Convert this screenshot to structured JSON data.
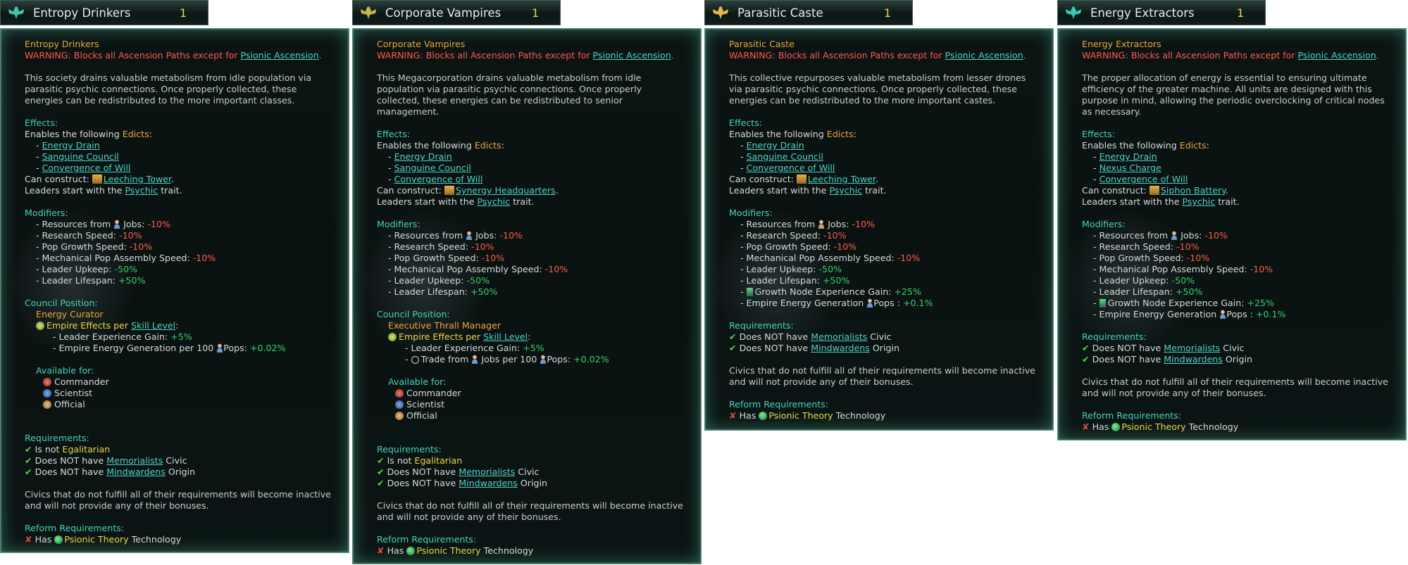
{
  "common": {
    "warning_prefix": "WARNING: Blocks all Ascension Paths except for",
    "warning_link": "Psionic Ascension",
    "effects_label": "Effects:",
    "enables_prefix": "Enables the following",
    "edicts_word": "Edicts",
    "can_construct": "Can construct:",
    "leaders_prefix": "Leaders start with the",
    "psychic": "Psychic",
    "trait_word": "trait.",
    "modifiers_label": "Modifiers:",
    "mod_resources": "- Resources from",
    "mod_jobs": "Jobs:",
    "mod_research": "- Research Speed:",
    "mod_pop_growth": "- Pop Growth Speed:",
    "mod_mech": "- Mechanical Pop Assembly Speed:",
    "mod_upkeep": "- Leader Upkeep:",
    "mod_lifespan": "- Leader Lifespan:",
    "mod_growth_node": "Growth Node Experience Gain:",
    "mod_energy_gen": "- Empire Energy Generation",
    "mod_pops_colon": "Pops :",
    "val_neg10": "-10%",
    "val_neg50": "-50%",
    "val_pos50": "+50%",
    "val_pos25": "+25%",
    "val_pos01": "+0.1%",
    "council_label": "Council Position:",
    "empire_effects": "Empire Effects per",
    "skill_level": "Skill Level",
    "leader_xp": "- Leader Experience Gain:",
    "val_pos5": "+5%",
    "available_for": "Available for:",
    "commander": "Commander",
    "scientist": "Scientist",
    "official": "Official",
    "requirements_label": "Requirements:",
    "is_not": "Is not",
    "egalitarian": "Egalitarian",
    "does_not_have": "Does NOT have",
    "memorialists": "Memorialists",
    "civic_word": "Civic",
    "mindwardens": "Mindwardens",
    "origin_word": "Origin",
    "civics_note": "Civics that do not fulfill all of their requirements will become inactive and will not provide any of their bonuses.",
    "reform_label": "Reform Requirements:",
    "has_word": "Has",
    "psionic_theory": "Psionic Theory",
    "technology_word": "Technology"
  },
  "panels": [
    {
      "name": "Entropy Drinkers",
      "count": "1",
      "emblem_color": "#3fc9b0",
      "description": "This society drains valuable metabolism from idle population via parasitic psychic connections. Once properly collected, these energies can be redistributed to the more important classes.",
      "edicts": [
        "Energy Drain",
        "Sanguine Council",
        "Convergence of Will"
      ],
      "building": "Leeching Tower",
      "council_title": "Energy Curator",
      "energy_per": "- Empire Energy Generation per 100",
      "energy_val": "+0.02%"
    },
    {
      "name": "Corporate Vampires",
      "count": "1",
      "emblem_color": "#c9b94a",
      "description": "This Megacorporation drains valuable metabolism from idle population via parasitic psychic connections. Once properly collected, these energies can be redistributed to senior management.",
      "edicts": [
        "Energy Drain",
        "Sanguine Council",
        "Convergence of Will"
      ],
      "building": "Synergy Headquarters",
      "council_title": "Executive Thrall Manager",
      "trade_from": "Trade from",
      "jobs_per": "Jobs per 100",
      "pops_colon": "Pops:",
      "trade_val": "+0.02%"
    },
    {
      "name": "Parasitic Caste",
      "count": "1",
      "emblem_color": "#e8b84a",
      "description": "This collective repurposes valuable metabolism from lesser drones via parasitic psychic connections. Once properly collected, these energies can be redistributed to the more important castes.",
      "edicts": [
        "Energy Drain",
        "Sanguine Council",
        "Convergence of Will"
      ],
      "building": "Leeching Tower"
    },
    {
      "name": "Energy Extractors",
      "count": "1",
      "emblem_color": "#3fc9b0",
      "description": "The proper allocation of energy is essential to ensuring ultimate efficiency of the greater machine. All units are designed with this purpose in mind, allowing the periodic overclocking of critical nodes as necessary.",
      "edicts": [
        "Energy Drain",
        "Nexus Charge",
        "Convergence of Will"
      ],
      "building": "Siphon Battery"
    }
  ]
}
